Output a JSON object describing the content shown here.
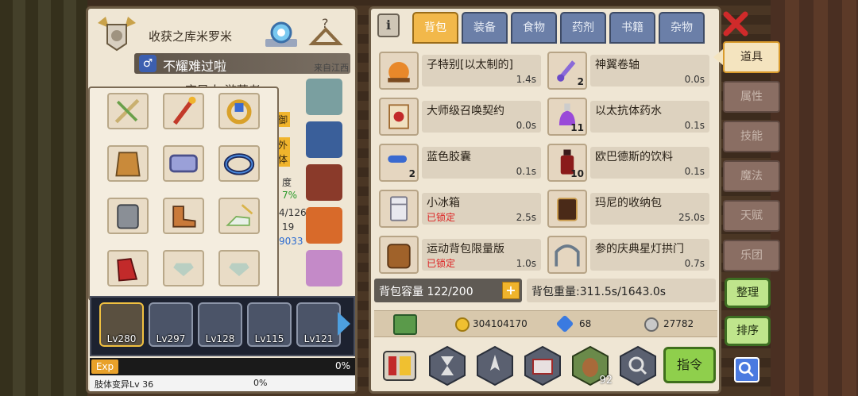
{
  "character": {
    "guild_name": "收获之库米罗米",
    "player_name": "不耀难过啦",
    "from_label": "来自江西",
    "title_partial": "变异人 游荡者",
    "partial_labels": [
      "御",
      "外",
      "体",
      "度",
      "7%",
      "4/126",
      "19",
      "9033"
    ]
  },
  "heroes": [
    {
      "level": "Lv280",
      "selected": true
    },
    {
      "level": "Lv297",
      "selected": false
    },
    {
      "level": "Lv128",
      "selected": false
    },
    {
      "level": "Lv115",
      "selected": false
    },
    {
      "level": "Lv121",
      "selected": false
    }
  ],
  "exp": {
    "label": "Exp",
    "percent": "0%"
  },
  "sub_progress": {
    "label": "肢体变异Lv 36",
    "percent": "0%"
  },
  "tabs": [
    "背包",
    "装备",
    "食物",
    "药剂",
    "书籍",
    "杂物"
  ],
  "active_tab": "背包",
  "items": [
    {
      "name": "子特别[以太制的]",
      "weight": "1.4s",
      "count": "",
      "locked": "",
      "icon": "pumpkin-cart-icon"
    },
    {
      "name": "神翼卷轴",
      "weight": "0.0s",
      "count": "2",
      "locked": "",
      "icon": "scroll-icon"
    },
    {
      "name": "大师级召唤契约",
      "weight": "0.0s",
      "count": "",
      "locked": "",
      "icon": "contract-icon"
    },
    {
      "name": "以太抗体药水",
      "weight": "0.1s",
      "count": "11",
      "locked": "",
      "icon": "potion-icon"
    },
    {
      "name": "蓝色胶囊",
      "weight": "0.1s",
      "count": "2",
      "locked": "",
      "icon": "capsule-icon"
    },
    {
      "name": "欧巴德斯的饮料",
      "weight": "0.1s",
      "count": "10",
      "locked": "",
      "icon": "drink-bottle-icon"
    },
    {
      "name": "小冰箱",
      "weight": "2.5s",
      "count": "",
      "locked": "已锁定",
      "icon": "fridge-icon"
    },
    {
      "name": "玛尼的收纳包",
      "weight": "25.0s",
      "count": "",
      "locked": "",
      "icon": "storage-bag-icon"
    },
    {
      "name": "运动背包限量版",
      "weight": "1.0s",
      "count": "",
      "locked": "已锁定",
      "icon": "backpack-icon"
    },
    {
      "name": "参的庆典星灯拱门",
      "weight": "0.7s",
      "count": "",
      "locked": "",
      "icon": "arch-icon"
    }
  ],
  "backpack": {
    "capacity_label": "背包容量 122/200",
    "weight_label": "背包重量:311.5s/1643.0s"
  },
  "currency": {
    "gold": "304104170",
    "diamond": "68",
    "silver": "27782"
  },
  "bottom_buttons": {
    "sort_count": "92",
    "command_label": "指令"
  },
  "side_menu": [
    "道具",
    "属性",
    "技能",
    "魔法",
    "天赋",
    "乐团"
  ],
  "side_active": "道具",
  "actions": {
    "organize": "整理",
    "sort": "排序"
  },
  "colors": {
    "tab_active": "#f2b84a",
    "tab_inactive": "#6b7fa8",
    "lock_red": "#dd2222",
    "command_green": "#8fcf4c"
  }
}
